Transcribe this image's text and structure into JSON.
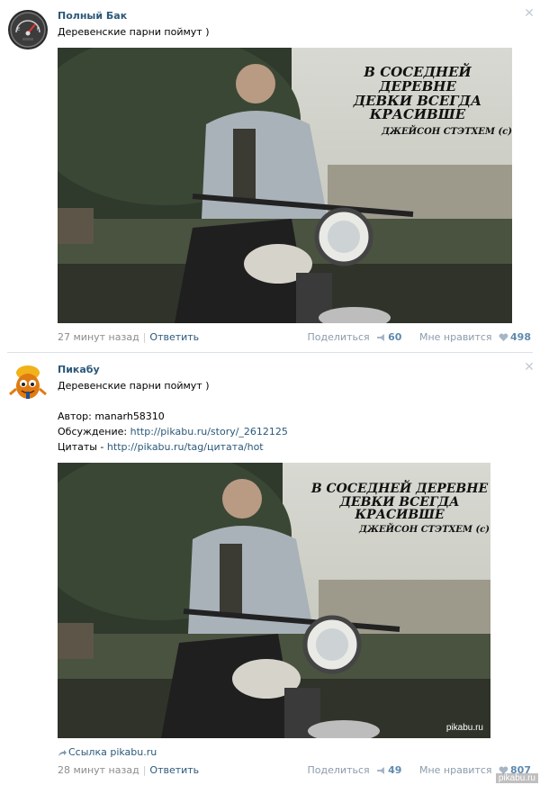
{
  "post1": {
    "author": "Полный Бак",
    "text": "Деревенские парни поймут )",
    "image": {
      "quote_line1": "В СОСЕДНЕЙ ДЕРЕВНЕ",
      "quote_line2": "ДЕВКИ ВСЕГДА",
      "quote_line3": "КРАСИВШЕ",
      "signature": "ДЖЕЙСОН СТЭТХЕМ (с)"
    },
    "footer": {
      "time": "27 минут назад",
      "reply": "Ответить",
      "share_label": "Поделиться",
      "share_count": "60",
      "like_label": "Мне нравится",
      "like_count": "498"
    }
  },
  "post2": {
    "author": "Пикабу",
    "text": "Деревенские парни поймут )",
    "author_line_label": "Автор:",
    "author_line_value": "manarh58310",
    "discussion_label": "Обсуждение:",
    "discussion_url": "http://pikabu.ru/story/_2612125",
    "quotes_label": "Цитаты -",
    "quotes_url": "http://pikabu.ru/tag/цитата/hot",
    "image": {
      "quote_line1": "В СОСЕДНЕЙ ДЕРЕВНЕ",
      "quote_line2": "ДЕВКИ ВСЕГДА",
      "quote_line3": "КРАСИВШЕ",
      "signature": "ДЖЕЙСОН СТЭТХЕМ (с)",
      "watermark": "pikabu.ru"
    },
    "link_label": "Ссылка",
    "link_value": "pikabu.ru",
    "footer": {
      "time": "28 минут назад",
      "reply": "Ответить",
      "share_label": "Поделиться",
      "share_count": "49",
      "like_label": "Мне нравится",
      "like_count": "807"
    }
  },
  "corner_stamp": "pikabu.ru",
  "icons": {
    "close": "close-icon",
    "share": "megaphone-icon",
    "like": "heart-icon",
    "link": "share-arrow-icon"
  },
  "colors": {
    "link": "#2b587a",
    "muted": "#8c8c8c",
    "count": "#5e8bb0",
    "divider": "#dae1e8"
  }
}
